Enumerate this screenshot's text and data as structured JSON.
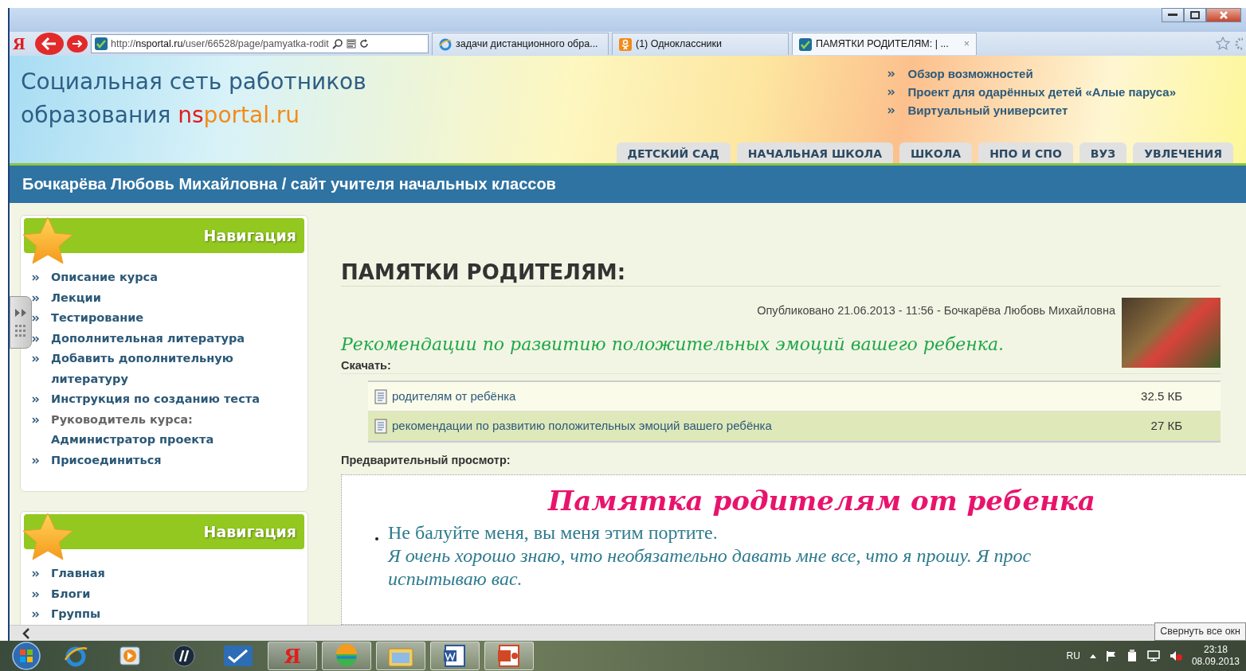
{
  "browser": {
    "logo": "Я",
    "address": "http://**nsportal.ru**/user/66528/page/pamyatka-rodit",
    "tab_close": "×",
    "tabs": [
      {
        "kind": "ie",
        "title": "задачи дистанционного обра...",
        "selected": false
      },
      {
        "kind": "ok",
        "title": "(1) Одноклассники",
        "selected": false
      },
      {
        "kind": "site",
        "title": "ПАМЯТКИ РОДИТЕЛЯМ: | ...",
        "selected": true
      }
    ]
  },
  "header": {
    "title_line1": "Социальная сеть работников",
    "title_line2": "образования",
    "brand_ns": "ns",
    "brand_portal": "portal.ru",
    "links": [
      "Обзор возможностей",
      "Проект для одарённых детей «Алые паруса»",
      "Виртуальный университет"
    ],
    "categories": [
      "ДЕТСКИЙ САД",
      "НАЧАЛЬНАЯ ШКОЛА",
      "ШКОЛА",
      "НПО И СПО",
      "ВУЗ",
      "УВЛЕЧЕНИЯ"
    ]
  },
  "site_bar": "Бочкарёва Любовь Михайловна / сайт учителя начальных классов",
  "sidebar": [
    {
      "title": "Навигация",
      "items": [
        {
          "kind": "link",
          "text": "Описание курса"
        },
        {
          "kind": "link",
          "text": "Лекции"
        },
        {
          "kind": "link",
          "text": "Тестирование"
        },
        {
          "kind": "link",
          "text": "Дополнительная литература"
        },
        {
          "kind": "link",
          "text": "Добавить дополнительную литературу"
        },
        {
          "kind": "link",
          "text": "Инструкция по созданию теста"
        },
        {
          "kind": "label",
          "text": "Руководитель курса:",
          "link": "Администратор проекта"
        },
        {
          "kind": "link",
          "text": "Присоединиться"
        }
      ]
    },
    {
      "title": "Навигация",
      "items": [
        {
          "kind": "link",
          "text": "Главная"
        },
        {
          "kind": "link",
          "text": "Блоги"
        },
        {
          "kind": "link",
          "text": "Группы"
        }
      ]
    }
  ],
  "article": {
    "title": "ПАМЯТКИ РОДИТЕЛЯМ:",
    "published": "Опубликовано 21.06.2013 - 11:56 -",
    "author": "Бочкарёва Любовь Михайловна",
    "subtitle": "Рекомендации по развитию положительных эмоций  вашего ребенка.",
    "download_label": "Скачать:",
    "files": [
      {
        "name": "родителям от ребёнка",
        "size": "32.5 КБ"
      },
      {
        "name": "рекомендации по развитию положительных эмоций вашего ребёнка",
        "size": "27 КБ"
      }
    ],
    "preview_label": "Предварительный просмотр:",
    "preview": {
      "title": "Памятка родителям от ребенка",
      "items": [
        {
          "text": "Не балуйте меня, вы меня этим портите.",
          "note": "Я очень хорошо знаю, что необязательно давать мне все, что я прошу. Я прос\nиспытываю вас."
        }
      ]
    }
  },
  "tooltip": "Свернуть все окн",
  "taskbar": {
    "apps": [
      {
        "kind": "ie",
        "running": false
      },
      {
        "kind": "media",
        "running": false
      },
      {
        "kind": "hp",
        "running": false
      },
      {
        "kind": "check",
        "running": false
      },
      {
        "kind": "yandex",
        "label": "Я",
        "running": true
      },
      {
        "kind": "ball",
        "running": true
      },
      {
        "kind": "folder",
        "running": true
      },
      {
        "kind": "word",
        "running": true
      },
      {
        "kind": "ppt",
        "running": true
      }
    ],
    "language": "RU",
    "time": "23:18",
    "date": "08.09.2013"
  }
}
